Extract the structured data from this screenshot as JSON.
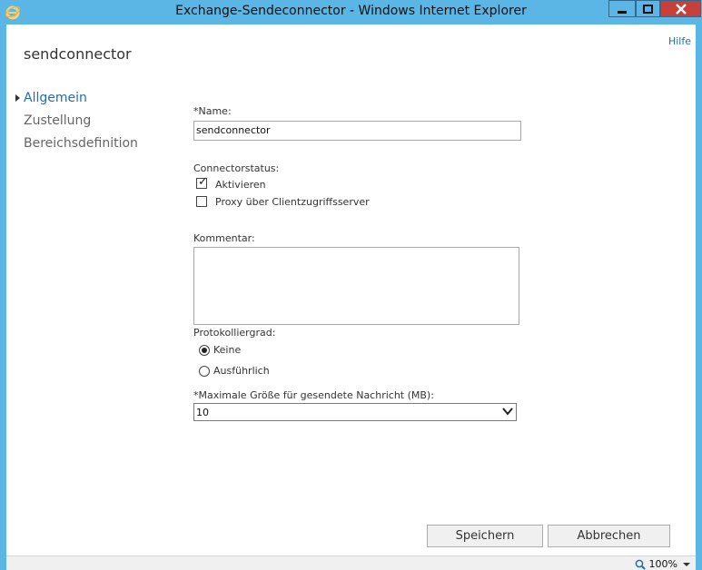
{
  "window": {
    "title": "Exchange-Sendeconnector - Windows Internet Explorer"
  },
  "page": {
    "title": "sendconnector",
    "help_label": "Hilfe"
  },
  "nav": {
    "items": [
      {
        "label": "Allgemein"
      },
      {
        "label": "Zustellung"
      },
      {
        "label": "Bereichsdefinition"
      }
    ]
  },
  "form": {
    "name_label": "*Name:",
    "name_value": "sendconnector",
    "status_label": "Connectorstatus:",
    "enable_label": "Aktivieren",
    "proxy_label": "Proxy über Clientzugriffsserver",
    "comment_label": "Kommentar:",
    "comment_value": "",
    "log_label": "Protokolliergrad:",
    "log_none_label": "Keine",
    "log_verbose_label": "Ausführlich",
    "max_size_label": "*Maximale Größe für gesendete Nachricht (MB):",
    "max_size_value": "10"
  },
  "buttons": {
    "save_label": "Speichern",
    "cancel_label": "Abbrechen"
  },
  "status": {
    "zoom": "100%"
  },
  "colors": {
    "titlebar": "#5bb6e6",
    "close": "#c7413a",
    "link": "#1e6faa"
  }
}
